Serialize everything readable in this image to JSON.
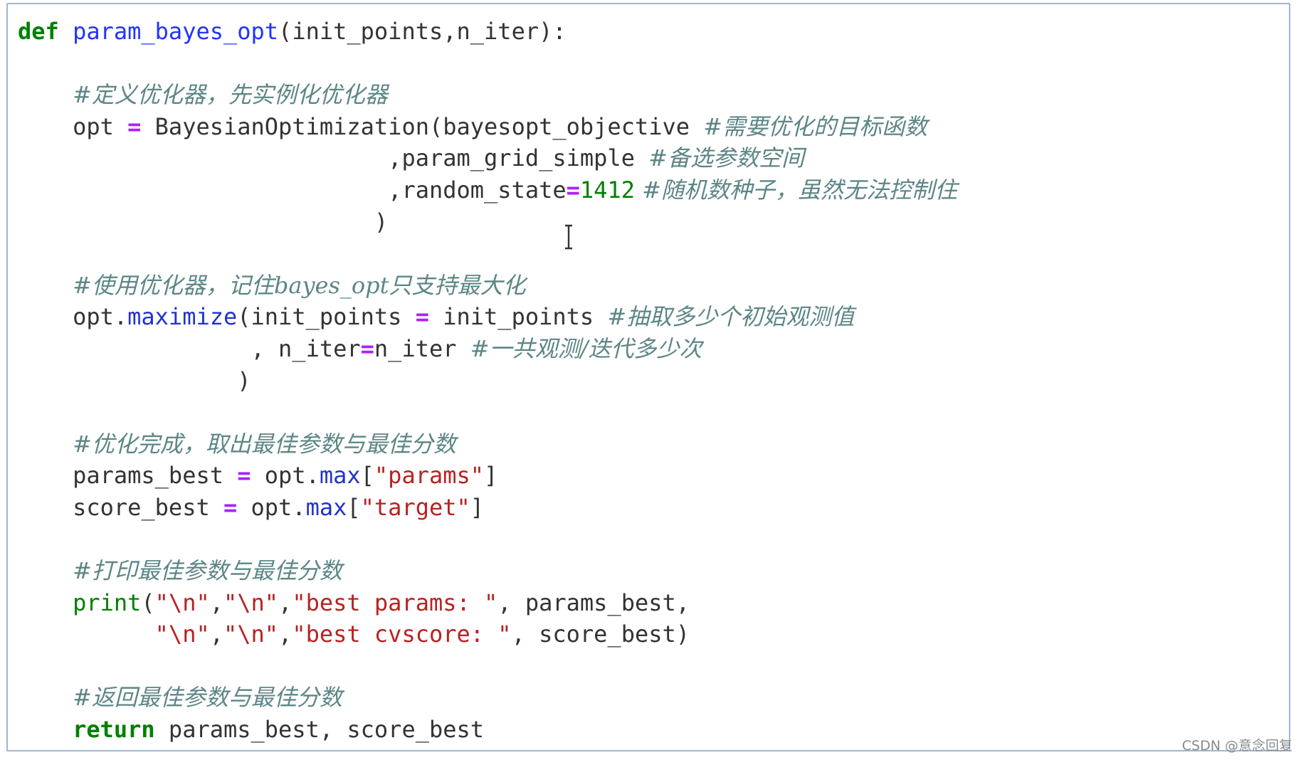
{
  "code": {
    "def_keyword": "def",
    "func_name": "param_bayes_opt",
    "func_params": "(init_points,n_iter):",
    "comment_1": "#定义优化器，先实例化优化器",
    "opt_var": "opt",
    "op_eq": "=",
    "bayes_class": "BayesianOptimization(bayesopt_objective ",
    "comment_objective": "#需要优化的目标函数",
    "param_grid_arg": ",param_grid_simple ",
    "comment_param_space": "#备选参数空间",
    "random_state_arg": ",random_state",
    "random_state_value": "1412",
    "comment_seed": " #随机数种子，虽然无法控制住",
    "close_paren": ")",
    "comment_2": "#使用优化器，记住bayes_opt只支持最大化",
    "maximize_prefix": "opt.",
    "maximize_method": "maximize",
    "maximize_args": "(init_points ",
    "maximize_args_2": " init_points ",
    "comment_init_points": "#抽取多少个初始观测值",
    "n_iter_arg_prefix": ", n_iter",
    "n_iter_arg_value": "n_iter ",
    "comment_n_iter": "#一共观测/迭代多少次",
    "comment_3": "#优化完成，取出最佳参数与最佳分数",
    "params_best_var": "params_best ",
    "score_best_var": "score_best ",
    "opt_dot": " opt.",
    "max_method": "max",
    "open_bracket": "[",
    "close_bracket": "]",
    "params_key": "\"params\"",
    "target_key": "\"target\"",
    "comment_4": "#打印最佳参数与最佳分数",
    "print_fn": "print",
    "print_line1_a": "(",
    "str_newline": "\"\\n\"",
    "comma": ",",
    "str_best_params": "\"best params: \"",
    "print_line1_tail": ", params_best,",
    "str_best_cvscore": "\"best cvscore: \"",
    "print_line2_tail": ", score_best)",
    "comment_5": "#返回最佳参数与最佳分数",
    "return_keyword": "return",
    "return_values": " params_best, score_best"
  },
  "watermark": "CSDN @意念回复",
  "colors": {
    "keyword": "#008000",
    "function_name": "#2233ff",
    "operator": "#aa22ff",
    "string": "#ba2121",
    "comment": "#5d8686",
    "cell_border": "#9fb6cf"
  },
  "icons": {
    "cursor": "text-cursor-icon"
  }
}
